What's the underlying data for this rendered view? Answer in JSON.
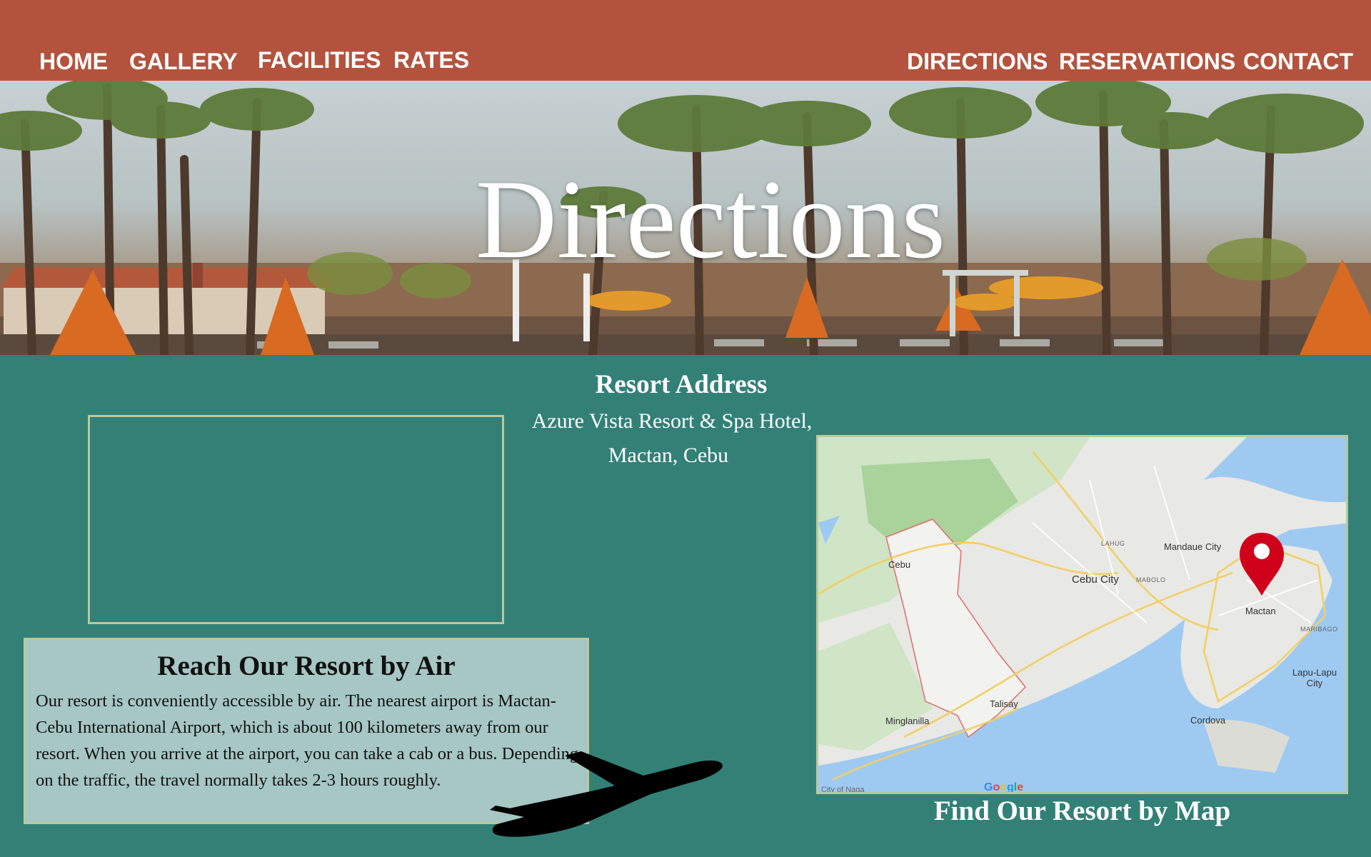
{
  "nav": {
    "home": "HOME",
    "gallery": "GALLERY",
    "facilities": "FACILITIES",
    "rates": "RATES",
    "directions": "DIRECTIONS",
    "reservations": "RESERVATIONS",
    "contact": "CONTACT"
  },
  "hero": {
    "title": "Directions"
  },
  "address": {
    "heading": "Resort Address",
    "line1": "Azure Vista Resort & Spa Hotel,",
    "line2": "Mactan, Cebu"
  },
  "air": {
    "title": "Reach Our Resort by Air",
    "text": "Our resort is conveniently accessible by air. The nearest airport is Mactan-Cebu International Airport, which is about 100 kilometers away from our resort. When you arrive at the airport, you can take a cab or a bus. Depending on the traffic, the travel normally takes 2-3 hours roughly."
  },
  "map": {
    "caption": "Find Our Resort by Map",
    "labels": {
      "cebu": "Cebu",
      "lahug": "LAHUG",
      "mandaue": "Mandaue City",
      "cebu_city": "Cebu City",
      "mabolo": "MABOLO",
      "mactan": "Mactan",
      "maribago": "MARIBAGO",
      "lapu_lapu": "Lapu-Lapu City",
      "talisay": "Talisay",
      "minglanilla": "Minglanilla",
      "cordova": "Cordova",
      "naga": "City of Naga",
      "google": "Google"
    }
  },
  "colors": {
    "nav_bg": "#b3533e",
    "page_bg": "#338077",
    "card_bg": "#a6c7c4",
    "border": "#b9c99d",
    "map_pin": "#d0021b"
  }
}
